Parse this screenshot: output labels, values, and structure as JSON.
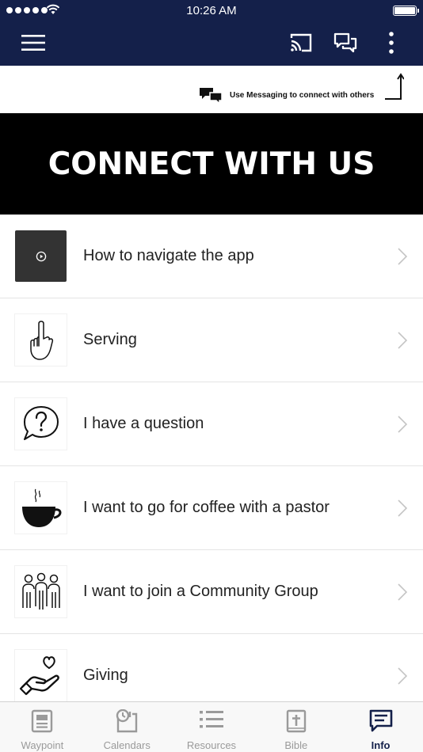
{
  "status_bar": {
    "time": "10:26 AM"
  },
  "colors": {
    "nav_bg": "#14204a",
    "banner_bg": "#000000",
    "tab_active": "#14204a",
    "tab_inactive": "#9a9a9a"
  },
  "nav": {
    "menu_icon": "hamburger-icon",
    "cast_icon": "cast-icon",
    "chat_icon": "messaging-icon",
    "more_icon": "more-vertical-icon"
  },
  "hint": {
    "text": "Use Messaging to connect with others"
  },
  "banner": {
    "title": "CONNECT WITH US"
  },
  "list": [
    {
      "label": "How to navigate the app",
      "icon": "play-icon"
    },
    {
      "label": "Serving",
      "icon": "raised-hand-icon"
    },
    {
      "label": "I have a question",
      "icon": "question-bubble-icon"
    },
    {
      "label": "I want to go for coffee with a pastor",
      "icon": "coffee-cup-icon"
    },
    {
      "label": "I want to join a Community Group",
      "icon": "group-people-icon"
    },
    {
      "label": "Giving",
      "icon": "heart-hand-icon"
    }
  ],
  "tabs": [
    {
      "label": "Waypoint",
      "icon": "waypoint-icon",
      "active": false
    },
    {
      "label": "Calendars",
      "icon": "calendar-icon",
      "active": false
    },
    {
      "label": "Resources",
      "icon": "list-icon",
      "active": false
    },
    {
      "label": "Bible",
      "icon": "bible-icon",
      "active": false
    },
    {
      "label": "Info",
      "icon": "info-chat-icon",
      "active": true
    }
  ]
}
